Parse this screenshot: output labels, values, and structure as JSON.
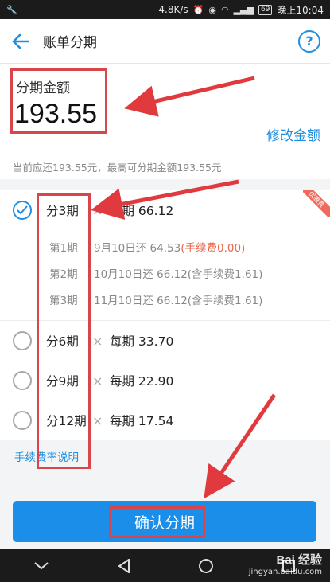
{
  "status_bar": {
    "speed": "4.8K/s",
    "battery": "69",
    "time": "晚上10:04"
  },
  "header": {
    "title": "账单分期"
  },
  "amount": {
    "label": "分期金额",
    "value": "193.55",
    "modify_label": "修改金额",
    "note": "当前应还193.55元，最高可分期金额193.55元"
  },
  "badge": "优惠费",
  "plans": [
    {
      "periods": "分3期",
      "times": "×",
      "each": "每期 66.12",
      "checked": true
    },
    {
      "periods": "分6期",
      "times": "×",
      "each": "每期 33.70",
      "checked": false
    },
    {
      "periods": "分9期",
      "times": "×",
      "each": "每期 22.90",
      "checked": false
    },
    {
      "periods": "分12期",
      "times": "×",
      "each": "每期 17.54",
      "checked": false
    }
  ],
  "details": [
    {
      "period": "第1期",
      "text": "9月10日还 64.53",
      "fee": "(手续费0.00)"
    },
    {
      "period": "第2期",
      "text": "10月10日还 66.12(含手续费1.61)",
      "fee": ""
    },
    {
      "period": "第3期",
      "text": "11月10日还 66.12(含手续费1.61)",
      "fee": ""
    }
  ],
  "fee_link": "手续费率说明",
  "confirm_label": "确认分期",
  "watermark": {
    "brand": "Bai 经验",
    "url": "jingyan.baidu.com"
  },
  "colors": {
    "accent": "#1e8fe1",
    "annotation_red": "#d8454a",
    "fee_red": "#e9654b"
  }
}
